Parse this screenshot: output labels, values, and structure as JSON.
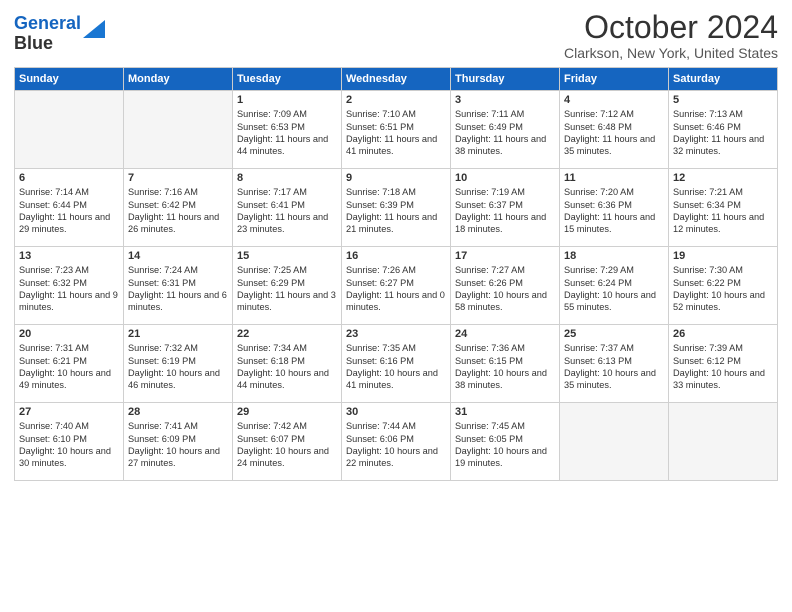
{
  "header": {
    "logo_line1": "General",
    "logo_line2": "Blue",
    "month": "October 2024",
    "location": "Clarkson, New York, United States"
  },
  "weekdays": [
    "Sunday",
    "Monday",
    "Tuesday",
    "Wednesday",
    "Thursday",
    "Friday",
    "Saturday"
  ],
  "weeks": [
    [
      {
        "day": "",
        "text": "",
        "empty": true
      },
      {
        "day": "",
        "text": "",
        "empty": true
      },
      {
        "day": "1",
        "text": "Sunrise: 7:09 AM\nSunset: 6:53 PM\nDaylight: 11 hours and 44 minutes."
      },
      {
        "day": "2",
        "text": "Sunrise: 7:10 AM\nSunset: 6:51 PM\nDaylight: 11 hours and 41 minutes."
      },
      {
        "day": "3",
        "text": "Sunrise: 7:11 AM\nSunset: 6:49 PM\nDaylight: 11 hours and 38 minutes."
      },
      {
        "day": "4",
        "text": "Sunrise: 7:12 AM\nSunset: 6:48 PM\nDaylight: 11 hours and 35 minutes."
      },
      {
        "day": "5",
        "text": "Sunrise: 7:13 AM\nSunset: 6:46 PM\nDaylight: 11 hours and 32 minutes."
      }
    ],
    [
      {
        "day": "6",
        "text": "Sunrise: 7:14 AM\nSunset: 6:44 PM\nDaylight: 11 hours and 29 minutes."
      },
      {
        "day": "7",
        "text": "Sunrise: 7:16 AM\nSunset: 6:42 PM\nDaylight: 11 hours and 26 minutes."
      },
      {
        "day": "8",
        "text": "Sunrise: 7:17 AM\nSunset: 6:41 PM\nDaylight: 11 hours and 23 minutes."
      },
      {
        "day": "9",
        "text": "Sunrise: 7:18 AM\nSunset: 6:39 PM\nDaylight: 11 hours and 21 minutes."
      },
      {
        "day": "10",
        "text": "Sunrise: 7:19 AM\nSunset: 6:37 PM\nDaylight: 11 hours and 18 minutes."
      },
      {
        "day": "11",
        "text": "Sunrise: 7:20 AM\nSunset: 6:36 PM\nDaylight: 11 hours and 15 minutes."
      },
      {
        "day": "12",
        "text": "Sunrise: 7:21 AM\nSunset: 6:34 PM\nDaylight: 11 hours and 12 minutes."
      }
    ],
    [
      {
        "day": "13",
        "text": "Sunrise: 7:23 AM\nSunset: 6:32 PM\nDaylight: 11 hours and 9 minutes."
      },
      {
        "day": "14",
        "text": "Sunrise: 7:24 AM\nSunset: 6:31 PM\nDaylight: 11 hours and 6 minutes."
      },
      {
        "day": "15",
        "text": "Sunrise: 7:25 AM\nSunset: 6:29 PM\nDaylight: 11 hours and 3 minutes."
      },
      {
        "day": "16",
        "text": "Sunrise: 7:26 AM\nSunset: 6:27 PM\nDaylight: 11 hours and 0 minutes."
      },
      {
        "day": "17",
        "text": "Sunrise: 7:27 AM\nSunset: 6:26 PM\nDaylight: 10 hours and 58 minutes."
      },
      {
        "day": "18",
        "text": "Sunrise: 7:29 AM\nSunset: 6:24 PM\nDaylight: 10 hours and 55 minutes."
      },
      {
        "day": "19",
        "text": "Sunrise: 7:30 AM\nSunset: 6:22 PM\nDaylight: 10 hours and 52 minutes."
      }
    ],
    [
      {
        "day": "20",
        "text": "Sunrise: 7:31 AM\nSunset: 6:21 PM\nDaylight: 10 hours and 49 minutes."
      },
      {
        "day": "21",
        "text": "Sunrise: 7:32 AM\nSunset: 6:19 PM\nDaylight: 10 hours and 46 minutes."
      },
      {
        "day": "22",
        "text": "Sunrise: 7:34 AM\nSunset: 6:18 PM\nDaylight: 10 hours and 44 minutes."
      },
      {
        "day": "23",
        "text": "Sunrise: 7:35 AM\nSunset: 6:16 PM\nDaylight: 10 hours and 41 minutes."
      },
      {
        "day": "24",
        "text": "Sunrise: 7:36 AM\nSunset: 6:15 PM\nDaylight: 10 hours and 38 minutes."
      },
      {
        "day": "25",
        "text": "Sunrise: 7:37 AM\nSunset: 6:13 PM\nDaylight: 10 hours and 35 minutes."
      },
      {
        "day": "26",
        "text": "Sunrise: 7:39 AM\nSunset: 6:12 PM\nDaylight: 10 hours and 33 minutes."
      }
    ],
    [
      {
        "day": "27",
        "text": "Sunrise: 7:40 AM\nSunset: 6:10 PM\nDaylight: 10 hours and 30 minutes."
      },
      {
        "day": "28",
        "text": "Sunrise: 7:41 AM\nSunset: 6:09 PM\nDaylight: 10 hours and 27 minutes."
      },
      {
        "day": "29",
        "text": "Sunrise: 7:42 AM\nSunset: 6:07 PM\nDaylight: 10 hours and 24 minutes."
      },
      {
        "day": "30",
        "text": "Sunrise: 7:44 AM\nSunset: 6:06 PM\nDaylight: 10 hours and 22 minutes."
      },
      {
        "day": "31",
        "text": "Sunrise: 7:45 AM\nSunset: 6:05 PM\nDaylight: 10 hours and 19 minutes."
      },
      {
        "day": "",
        "text": "",
        "empty": true
      },
      {
        "day": "",
        "text": "",
        "empty": true
      }
    ]
  ]
}
